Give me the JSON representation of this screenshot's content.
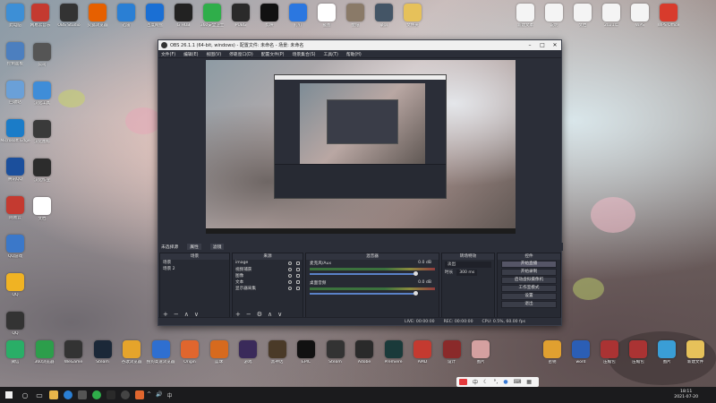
{
  "colors": {
    "obs_bg": "#2b2e38",
    "taskbar": "#1b1b1d",
    "accent_blue": "#5a82c8"
  },
  "desktop_left_col": [
    {
      "label": "此电脑",
      "color": "#3d8fd6",
      "icon": "computer-icon"
    },
    {
      "label": "控制面板",
      "color": "#4c7fbf",
      "icon": "control-panel-icon"
    },
    {
      "label": "回收站",
      "color": "#6aa0d8",
      "icon": "recycle-bin-icon"
    },
    {
      "label": "Microsoft Edge",
      "color": "#1b7cc8",
      "icon": "edge-icon"
    },
    {
      "label": "腾讯QQ",
      "color": "#1b4f9c",
      "icon": "qq-icon"
    },
    {
      "label": "网易云",
      "color": "#c43a30",
      "icon": "music-icon"
    },
    {
      "label": "QQ游戏",
      "color": "#3b78c9",
      "icon": "game-icon"
    },
    {
      "label": "QQ",
      "color": "#f0b323",
      "icon": "qq-penguin-icon"
    },
    {
      "label": "QQ",
      "color": "#333333",
      "icon": "qq-penguin-icon"
    }
  ],
  "desktop_left_col2": [
    {
      "label": "公司",
      "color": "#555555"
    },
    {
      "label": "汉化工具",
      "color": "#3f8dd8"
    },
    {
      "label": "汉化图标",
      "color": "#3a3a3a"
    },
    {
      "label": "汉化作业",
      "color": "#2c2c2c"
    },
    {
      "label": "文档",
      "color": "#ffffff"
    }
  ],
  "desktop_top_row": [
    {
      "label": "网易云音乐",
      "color": "#c43a30"
    },
    {
      "label": "OBS Studio",
      "color": "#333333"
    },
    {
      "label": "火狐浏览器",
      "color": "#e66000"
    },
    {
      "label": "迅雷",
      "color": "#2a7fd4"
    },
    {
      "label": "百度网盘",
      "color": "#1a6fd4"
    },
    {
      "label": "G HUB",
      "color": "#222222"
    },
    {
      "label": "360安全卫士",
      "color": "#2fae4a"
    },
    {
      "label": "PUBG",
      "color": "#2a2a2a"
    },
    {
      "label": "剪映",
      "color": "#111111"
    },
    {
      "label": "钉钉",
      "color": "#2b77e0"
    },
    {
      "label": "截图",
      "color": "#ffffff"
    },
    {
      "label": "壁纸",
      "color": "#8a7a68"
    },
    {
      "label": "录屏",
      "color": "#445566"
    },
    {
      "label": "文件夹",
      "color": "#e6c15a"
    }
  ],
  "desktop_top_right": [
    {
      "label": "新建文本",
      "color": "#f4f4f4"
    },
    {
      "label": "说明",
      "color": "#f4f4f4"
    },
    {
      "label": "文档",
      "color": "#f4f4f4"
    },
    {
      "label": "2021年",
      "color": "#f4f4f4"
    },
    {
      "label": "WPS",
      "color": "#f4f4f4"
    },
    {
      "label": "WPS Office",
      "color": "#d83b2c"
    }
  ],
  "desktop_bottom_row": [
    {
      "label": "微信",
      "color": "#2aae67"
    },
    {
      "label": "360浏览器",
      "color": "#2c9e4b"
    },
    {
      "label": "WeGame",
      "color": "#333333"
    },
    {
      "label": "Steam",
      "color": "#1b2838"
    },
    {
      "label": "谷歌浏览器",
      "color": "#e5a42b"
    },
    {
      "label": "搜狗高速浏览器",
      "color": "#2f6fd0"
    },
    {
      "label": "Origin",
      "color": "#e0662e"
    },
    {
      "label": "篮球",
      "color": "#d66a1e"
    },
    {
      "label": "游戏",
      "color": "#3a2a5a"
    },
    {
      "label": "黑神话",
      "color": "#4a3a28"
    },
    {
      "label": "EPIC",
      "color": "#111111"
    },
    {
      "label": "Steam",
      "color": "#333333"
    },
    {
      "label": "Adobe",
      "color": "#2a2a2a"
    },
    {
      "label": "Premiere",
      "color": "#1a3a3a"
    },
    {
      "label": "AMD",
      "color": "#c43a30"
    },
    {
      "label": "设计",
      "color": "#8a2a2a"
    },
    {
      "label": "图片",
      "color": "#d4a0a0"
    }
  ],
  "desktop_bottom_right": [
    {
      "label": "密钥",
      "color": "#e0a030"
    },
    {
      "label": "word",
      "color": "#2b5eb5"
    },
    {
      "label": "压缩包",
      "color": "#aa3333"
    },
    {
      "label": "压缩包",
      "color": "#aa3333"
    },
    {
      "label": "图片",
      "color": "#3a9ed6"
    },
    {
      "label": "新建文件",
      "color": "#e6c15a"
    }
  ],
  "obs": {
    "title": "OBS 26.1.1 (64-bit, windows) - 配置文件: 未命名 - 场景: 未命名",
    "menu": [
      "文件(F)",
      "编辑(E)",
      "视图(V)",
      "停靠窗口(D)",
      "配置文件(P)",
      "场景集合(S)",
      "工具(T)",
      "帮助(H)"
    ],
    "source_tabs_label": "未选择源",
    "prop_btn": "属性",
    "filter_btn": "滤镜",
    "scenes_header": "场景",
    "scenes": [
      "场景",
      "场景 2"
    ],
    "sources_header": "来源",
    "sources": [
      "image",
      "视频捕获",
      "图像",
      "文本",
      "显示器采集"
    ],
    "mixer_header": "混音器",
    "mixer": [
      {
        "name": "麦克风/Aux",
        "db": "0.0 dB"
      },
      {
        "name": "桌面音频",
        "db": "0.0 dB"
      }
    ],
    "transition_header": "转场特效",
    "transition_type": "淡出",
    "duration_label": "时长",
    "duration_value": "300 ms",
    "controls_header": "控件",
    "controls": [
      "开始直播",
      "开始录制",
      "启动虚拟摄像机",
      "工作室模式",
      "设置",
      "退出"
    ],
    "status_live": "LIVE: 00:00:00",
    "status_rec": "REC: 00:00:00",
    "status_cpu": "CPU: 0.5%, 60.00 fps"
  },
  "taskbar": {
    "clock_time": "18:11",
    "clock_date": "2021-07-20",
    "tray": [
      "^",
      "🔊",
      "中"
    ]
  }
}
